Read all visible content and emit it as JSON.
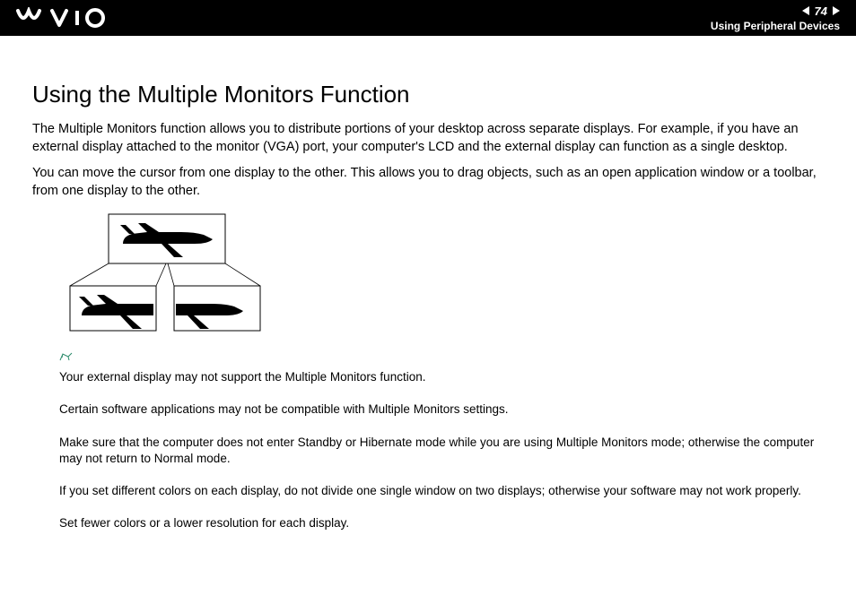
{
  "header": {
    "logo": "VAIO",
    "page_number": "74",
    "section": "Using Peripheral Devices"
  },
  "title": "Using the Multiple Monitors Function",
  "paragraphs": [
    "The Multiple Monitors function allows you to distribute portions of your desktop across separate displays. For example, if you have an external display attached to the monitor (VGA) port, your computer's LCD and the external display can function as a single desktop.",
    "You can move the cursor from one display to the other. This allows you to drag objects, such as an open application window or a toolbar, from one display to the other."
  ],
  "notes": [
    "Your external display may not support the Multiple Monitors function.",
    "Certain software applications may not be compatible with Multiple Monitors settings.",
    "Make sure that the computer does not enter Standby or Hibernate mode while you are using Multiple Monitors mode; otherwise the computer may not return to Normal mode.",
    "If you set different colors on each display, do not divide one single window on two displays; otherwise your software may not work properly.",
    "Set fewer colors or a lower resolution for each display."
  ],
  "diagram": {
    "description": "Airplane image split across one main display and two smaller displays below"
  }
}
